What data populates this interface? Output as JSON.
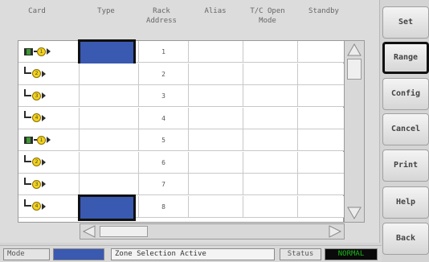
{
  "headers": {
    "card": "Card",
    "type": "Type",
    "rack_address": [
      "Rack",
      "Address"
    ],
    "alias": "Alias",
    "tc_open_mode": [
      "T/C Open",
      "Mode"
    ],
    "standby": "Standby"
  },
  "rows": [
    {
      "node": "1",
      "slot": true,
      "address": "1",
      "type_selected": true
    },
    {
      "node": "2",
      "slot": false,
      "address": "2",
      "type_selected": false
    },
    {
      "node": "3",
      "slot": false,
      "address": "3",
      "type_selected": false
    },
    {
      "node": "4",
      "slot": false,
      "address": "4",
      "type_selected": false
    },
    {
      "node": "1",
      "slot": true,
      "address": "5",
      "type_selected": false
    },
    {
      "node": "2",
      "slot": false,
      "address": "6",
      "type_selected": false
    },
    {
      "node": "3",
      "slot": false,
      "address": "7",
      "type_selected": false
    },
    {
      "node": "4",
      "slot": false,
      "address": "8",
      "type_selected": true
    }
  ],
  "buttons": [
    {
      "id": "set",
      "label": "Set",
      "active": false
    },
    {
      "id": "range",
      "label": "Range",
      "active": true
    },
    {
      "id": "config",
      "label": "Config",
      "active": false
    },
    {
      "id": "cancel",
      "label": "Cancel",
      "active": false
    },
    {
      "id": "print",
      "label": "Print",
      "active": false
    },
    {
      "id": "help",
      "label": "Help",
      "active": false
    },
    {
      "id": "back",
      "label": "Back",
      "active": false
    }
  ],
  "status_bar": {
    "mode_label": "Mode",
    "message": "Zone Selection Active",
    "status_label": "Status",
    "status_value": "NORMAL"
  },
  "colors": {
    "selection": "#3a59b0",
    "status_ok_text": "#1db51d",
    "status_ok_bg": "#0a0a0a",
    "node_yellow": "#f2d21c",
    "slot_green": "#3c9a32"
  }
}
